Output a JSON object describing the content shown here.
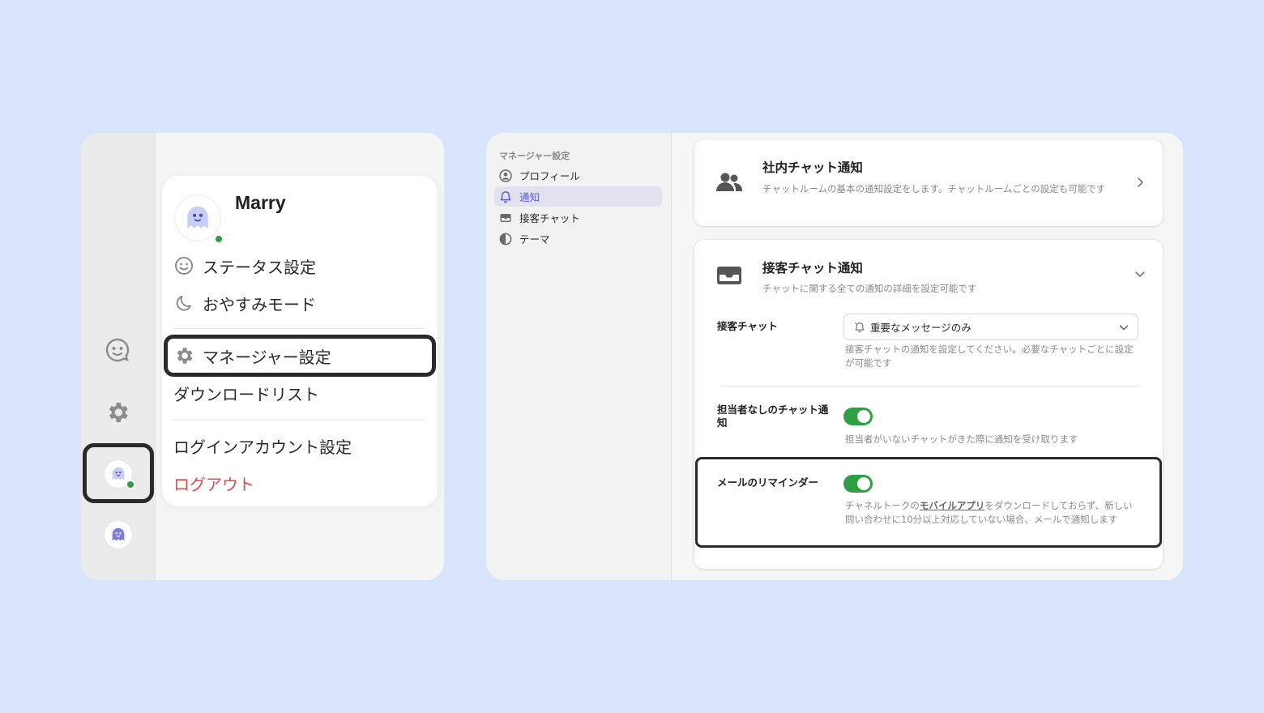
{
  "colors": {
    "background": "#d8e5fc",
    "accent": "#5b5bd6",
    "online": "#2ea043",
    "danger": "#e5484d",
    "toggle_on": "#2ea043"
  },
  "menu": {
    "user_name": "Marry",
    "items": {
      "status": "ステータス設定",
      "sleep": "おやすみモード",
      "manager_settings": "マネージャー設定",
      "download_list": "ダウンロードリスト",
      "login_account": "ログインアカウント設定",
      "logout": "ログアウト"
    }
  },
  "settings_nav": {
    "section_title": "マネージャー設定",
    "items": [
      {
        "label": "プロフィール",
        "icon": "user-circle-icon",
        "active": false
      },
      {
        "label": "通知",
        "icon": "bell-icon",
        "active": true
      },
      {
        "label": "接客チャット",
        "icon": "inbox-icon",
        "active": false
      },
      {
        "label": "テーマ",
        "icon": "contrast-icon",
        "active": false
      }
    ]
  },
  "internal_chat": {
    "title": "社内チャット通知",
    "description": "チャットルームの基本の通知設定をします。チャットルームごとの設定も可能です"
  },
  "customer_chat": {
    "title": "接客チャット通知",
    "description": "チャットに関する全ての通知の詳細を設定可能です",
    "chat_row": {
      "label": "接客チャット",
      "selected": "重要なメッセージのみ",
      "help": "接客チャットの通知を設定してください。必要なチャットごとに設定が可能です"
    },
    "unassigned_row": {
      "label": "担当者なしのチャット通知",
      "enabled": true,
      "help": "担当者がいないチャットがきた際に通知を受け取ります"
    },
    "email_row": {
      "label": "メールのリマインダー",
      "enabled": true,
      "help_before": "チャネルトークの",
      "help_link": "モバイルアプリ",
      "help_after": "をダウンロードしておらず、新しい問い合わせに10分以上対応していない場合、メールで通知します"
    }
  }
}
